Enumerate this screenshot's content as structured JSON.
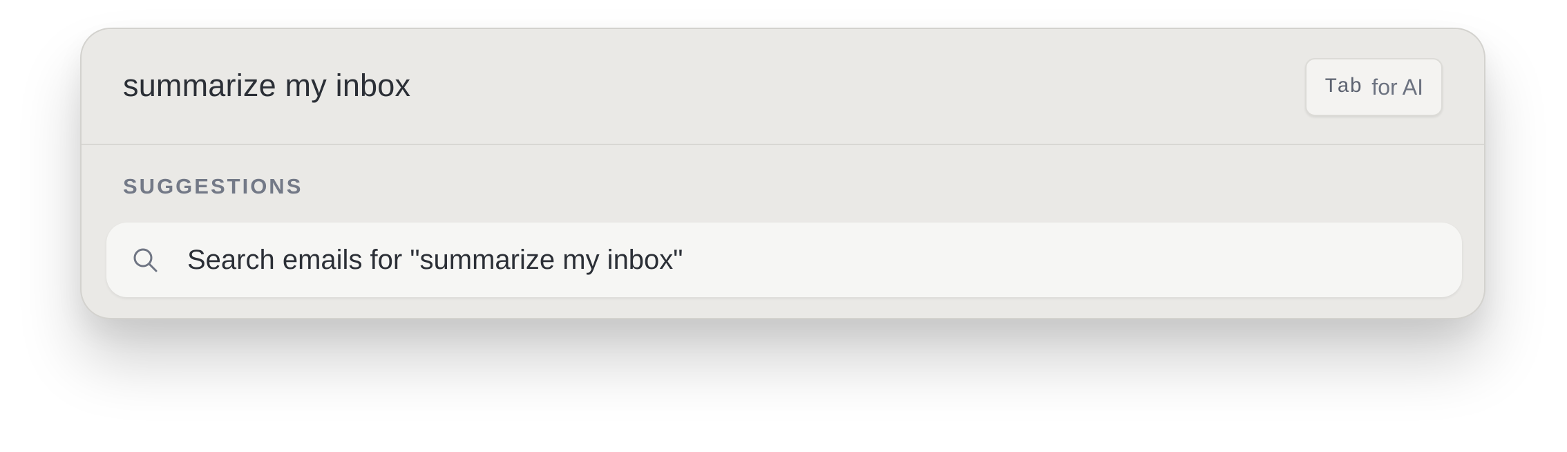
{
  "search": {
    "query": "summarize my inbox"
  },
  "tab_hint": {
    "key": "Tab",
    "label": "for AI"
  },
  "suggestions": {
    "section_title": "SUGGESTIONS",
    "items": [
      {
        "icon": "search-icon",
        "label": "Search emails for \"summarize my inbox\""
      }
    ]
  }
}
